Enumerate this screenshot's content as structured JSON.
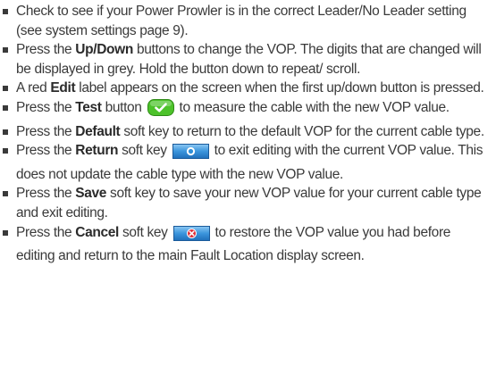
{
  "instructions": [
    {
      "parts": [
        {
          "t": "Check to see if your Power Prowler is in the correct Leader/No Leader setting (see system settings page 9)."
        }
      ]
    },
    {
      "parts": [
        {
          "t": "Press the "
        },
        {
          "b": "Up/Down"
        },
        {
          "t": " buttons to change the VOP. The digits that are changed will be displayed in grey.  Hold the button down to repeat/ scroll."
        }
      ]
    },
    {
      "parts": [
        {
          "t": "A red "
        },
        {
          "b": "Edit"
        },
        {
          "t": " label appears on the screen when the first up/down button is pressed."
        }
      ]
    },
    {
      "parts": [
        {
          "t": "Press the "
        },
        {
          "b": "Test"
        },
        {
          "t": " button "
        },
        {
          "icon": "test-checkmark-icon"
        },
        {
          "t": " to measure the cable with the new VOP value."
        }
      ]
    },
    {
      "parts": [
        {
          "t": "Press the "
        },
        {
          "b": "Default"
        },
        {
          "t": " soft key to return to the default VOP for the current cable type."
        }
      ]
    },
    {
      "parts": [
        {
          "t": "Press the "
        },
        {
          "b": "Return"
        },
        {
          "t": " soft key "
        },
        {
          "icon": "return-softkey-icon"
        },
        {
          "t": " to exit editing with the current VOP value.  This does not update the cable type with the new VOP value."
        }
      ]
    },
    {
      "parts": [
        {
          "t": "Press the "
        },
        {
          "b": "Save"
        },
        {
          "t": " soft key to save your new VOP value for your current cable type and exit editing."
        }
      ]
    },
    {
      "parts": [
        {
          "t": "Press the "
        },
        {
          "b": "Cancel"
        },
        {
          "t": " soft key "
        },
        {
          "icon": "cancel-softkey-icon"
        },
        {
          "t": " to restore the VOP value you had before editing and return to the main Fault Location display screen."
        }
      ]
    }
  ],
  "colors": {
    "text": "#3a3a3a",
    "test_button_green": "#4cc22a",
    "softkey_blue": "#2f8fd8",
    "cancel_red": "#e0303a"
  }
}
